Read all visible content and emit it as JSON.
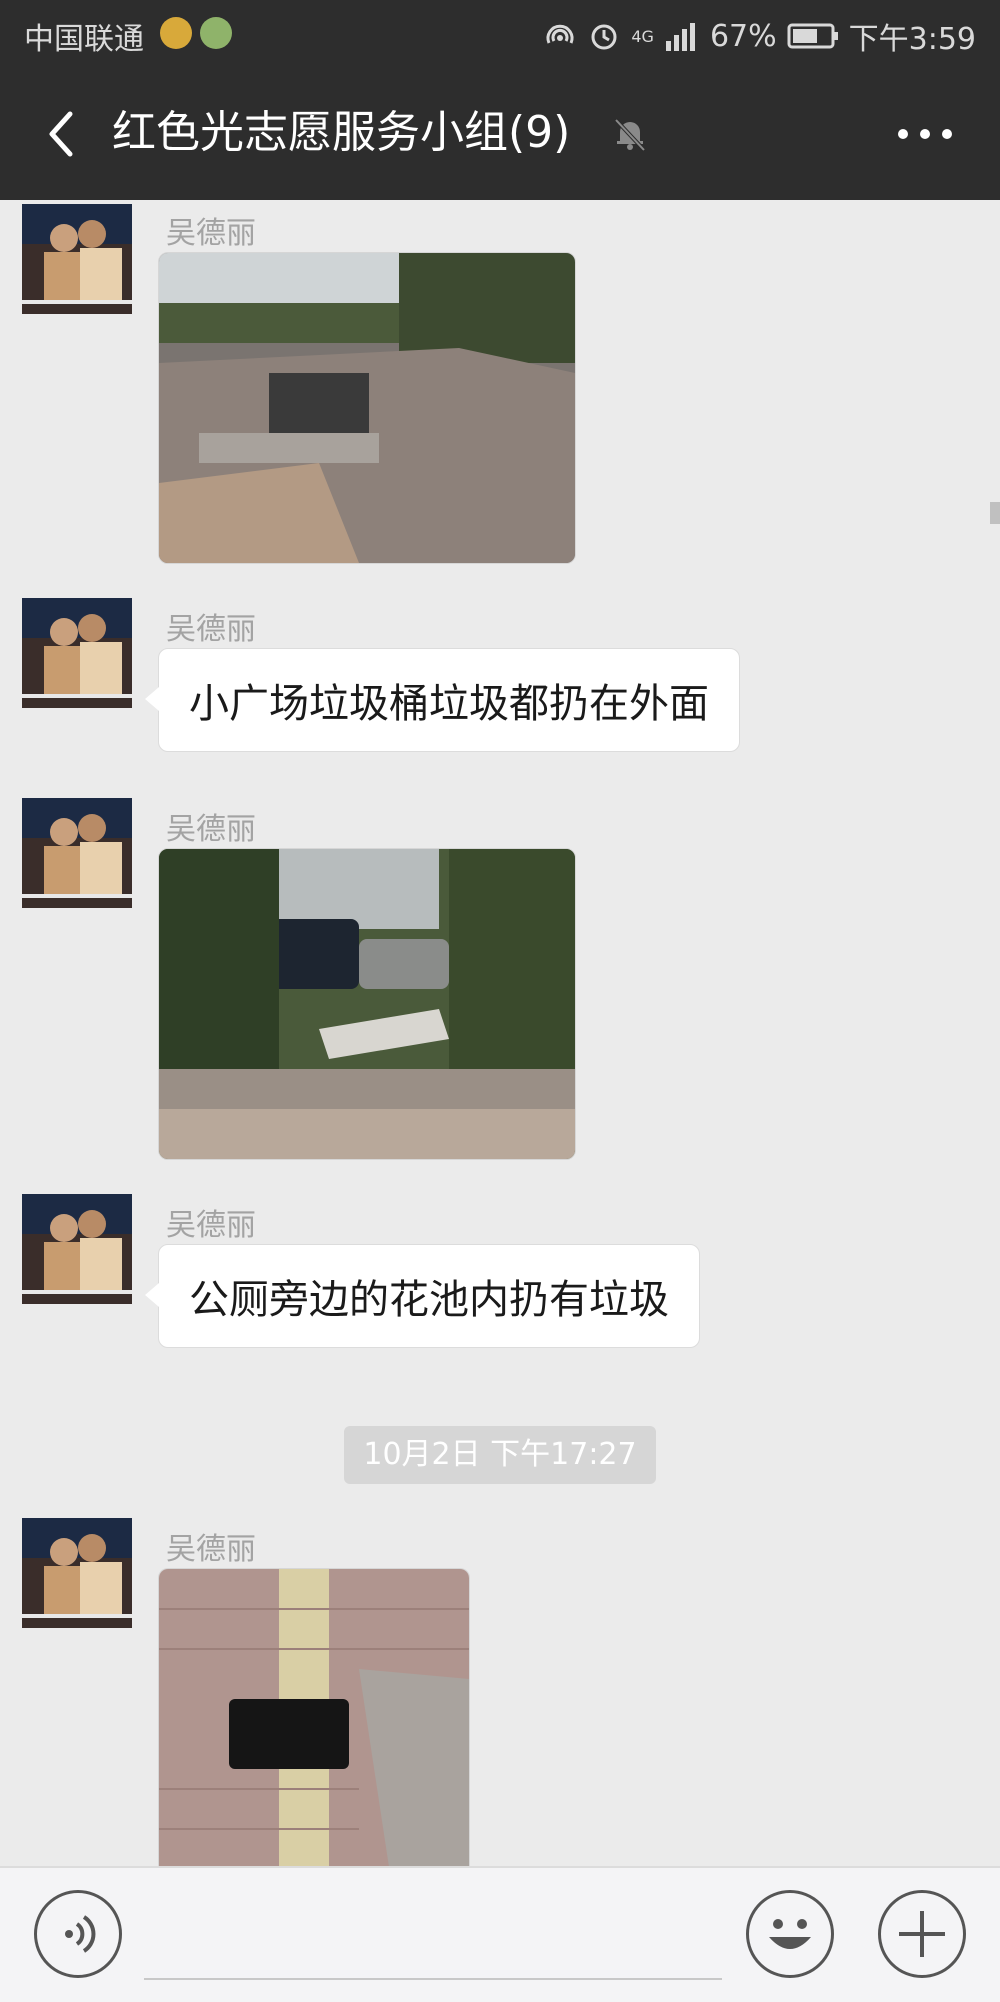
{
  "status_bar": {
    "carrier": "中国联通",
    "battery": "67%",
    "time": "下午3:59",
    "signal_label": "4G"
  },
  "header": {
    "title": "红色光志愿服务小组(9)",
    "icons": {
      "back": "back-arrow-icon",
      "mute": "mute-bell-icon",
      "more": "more-options-icon"
    }
  },
  "messages": [
    {
      "sender": "吴德丽",
      "type": "image",
      "alt": "street trash bins"
    },
    {
      "sender": "吴德丽",
      "type": "text",
      "text": "小广场垃圾桶垃圾都扔在外面"
    },
    {
      "sender": "吴德丽",
      "type": "image",
      "alt": "trash in bushes near car"
    },
    {
      "sender": "吴德丽",
      "type": "text",
      "text": "公厕旁边的花池内扔有垃圾"
    },
    {
      "sender": "吴德丽",
      "type": "image",
      "alt": "black bag on brick sidewalk"
    }
  ],
  "timestamp": "10月2日 下午17:27",
  "input_bar": {
    "icons": [
      "voice-icon",
      "emoji-icon",
      "plus-icon"
    ]
  },
  "colors": {
    "header_bg": "#2d2d2d",
    "chat_bg": "#ebebeb",
    "bubble_bg": "#ffffff",
    "timestamp_bg": "#d6d6d6"
  }
}
